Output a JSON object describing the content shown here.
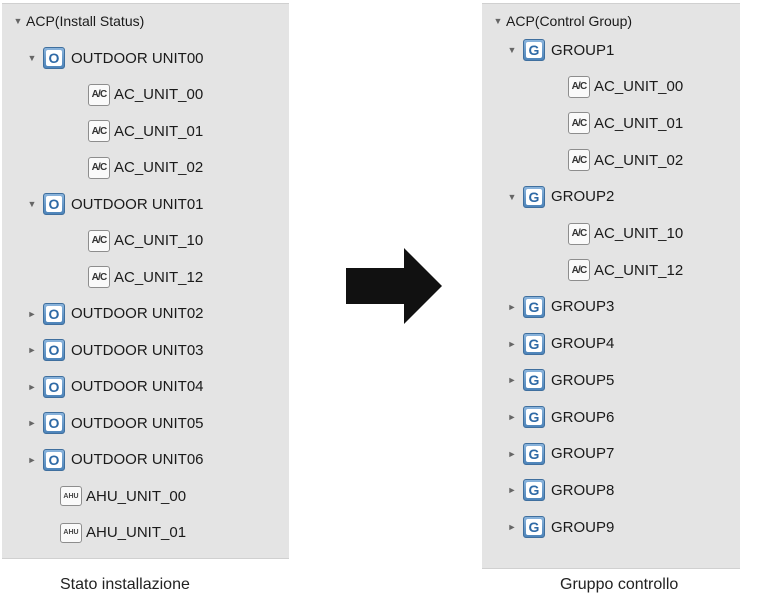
{
  "install_tree": {
    "root": "ACP(Install Status)",
    "rows": [
      {
        "kind": "unit",
        "arrow": "▼",
        "label": "OUTDOOR UNIT00"
      },
      {
        "kind": "ac",
        "label": "AC_UNIT_00"
      },
      {
        "kind": "ac",
        "label": "AC_UNIT_01"
      },
      {
        "kind": "ac",
        "label": "AC_UNIT_02"
      },
      {
        "kind": "unit",
        "arrow": "▼",
        "label": "OUTDOOR UNIT01"
      },
      {
        "kind": "ac",
        "label": "AC_UNIT_10"
      },
      {
        "kind": "ac",
        "label": "AC_UNIT_12"
      },
      {
        "kind": "unit",
        "arrow": "►",
        "label": "OUTDOOR UNIT02"
      },
      {
        "kind": "unit",
        "arrow": "►",
        "label": "OUTDOOR UNIT03"
      },
      {
        "kind": "unit",
        "arrow": "►",
        "label": "OUTDOOR UNIT04"
      },
      {
        "kind": "unit",
        "arrow": "►",
        "label": "OUTDOOR UNIT05"
      },
      {
        "kind": "unit",
        "arrow": "►",
        "label": "OUTDOOR UNIT06"
      },
      {
        "kind": "ahu",
        "label": "AHU_UNIT_00"
      },
      {
        "kind": "ahu",
        "label": "AHU_UNIT_01"
      }
    ]
  },
  "group_tree": {
    "root": "ACP(Control Group)",
    "rows": [
      {
        "kind": "group",
        "arrow": "▼",
        "label": "GROUP1"
      },
      {
        "kind": "ac",
        "label": "AC_UNIT_00"
      },
      {
        "kind": "ac",
        "label": "AC_UNIT_01"
      },
      {
        "kind": "ac",
        "label": "AC_UNIT_02"
      },
      {
        "kind": "group",
        "arrow": "▼",
        "label": "GROUP2"
      },
      {
        "kind": "ac",
        "label": "AC_UNIT_10"
      },
      {
        "kind": "ac",
        "label": "AC_UNIT_12"
      },
      {
        "kind": "group",
        "arrow": "►",
        "label": "GROUP3"
      },
      {
        "kind": "group",
        "arrow": "►",
        "label": "GROUP4"
      },
      {
        "kind": "group",
        "arrow": "►",
        "label": "GROUP5"
      },
      {
        "kind": "group",
        "arrow": "►",
        "label": "GROUP6"
      },
      {
        "kind": "group",
        "arrow": "►",
        "label": "GROUP7"
      },
      {
        "kind": "group",
        "arrow": "►",
        "label": "GROUP8"
      },
      {
        "kind": "group",
        "arrow": "►",
        "label": "GROUP9"
      }
    ]
  },
  "icons": {
    "unit_icon": "outdoor-unit-icon",
    "group_icon": "group-icon",
    "ac_icon": "ac-unit-icon",
    "ahu_icon": "ahu-unit-icon",
    "transition": "right-arrow-icon",
    "unit_letter": "O",
    "group_letter": "G",
    "ac_letters": "A/C",
    "ahu_letters": "AHU"
  },
  "captions": {
    "left": "Stato installazione",
    "right": "Gruppo controllo"
  },
  "colors": {
    "panel_bg": "#e4e4e4",
    "icon_blue": "#4d84ba",
    "arrow": "#111111"
  }
}
